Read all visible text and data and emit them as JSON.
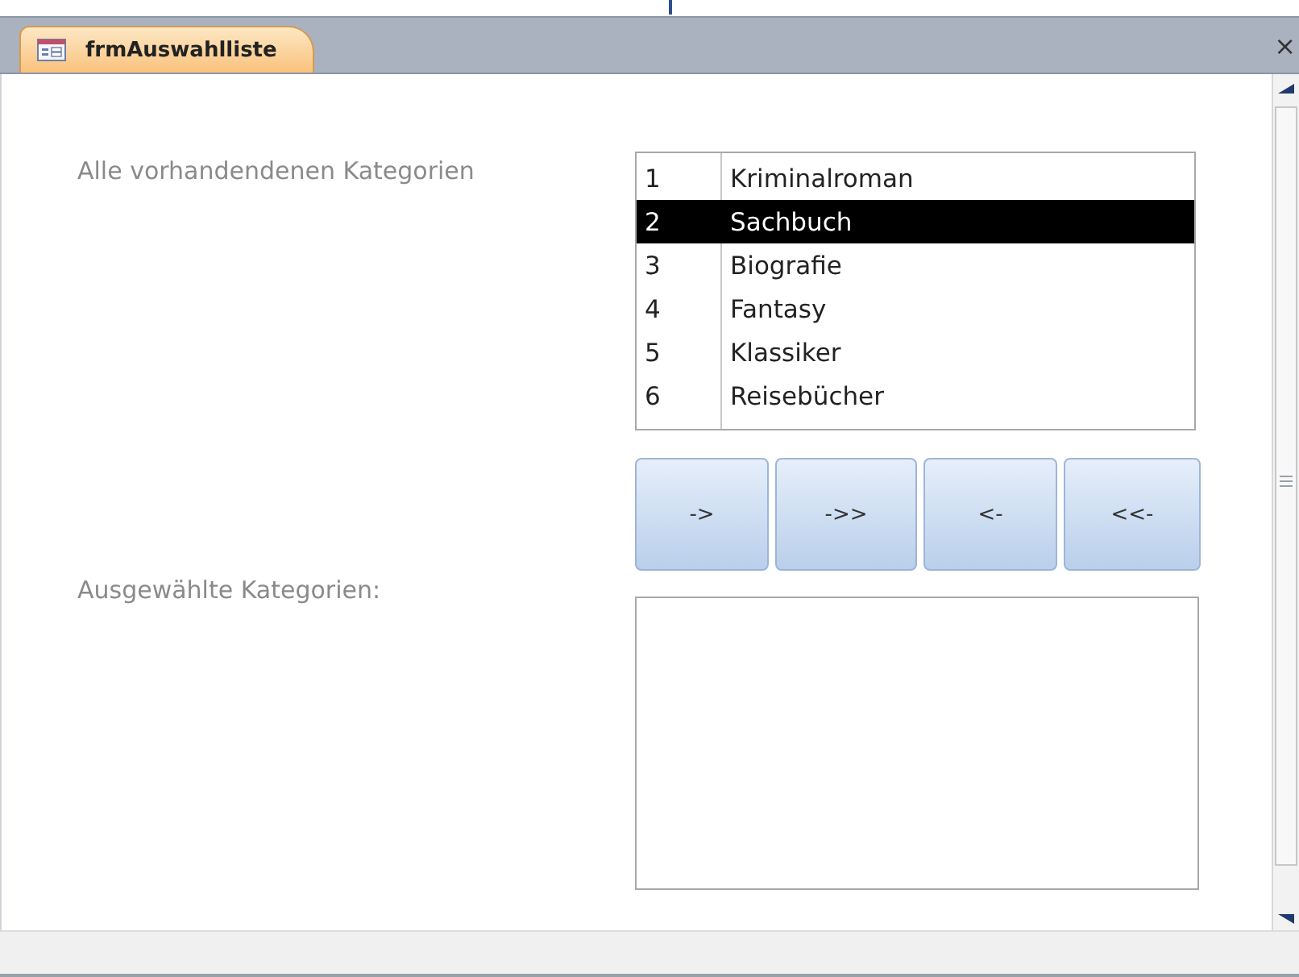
{
  "document_tab": {
    "title": "frmAuswahlliste",
    "close": "×"
  },
  "available": {
    "label": "Alle vorhandendenen Kategorien",
    "rows": [
      {
        "id": "1",
        "name": "Kriminalroman",
        "selected": false
      },
      {
        "id": "2",
        "name": "Sachbuch",
        "selected": true
      },
      {
        "id": "3",
        "name": "Biografie",
        "selected": false
      },
      {
        "id": "4",
        "name": "Fantasy",
        "selected": false
      },
      {
        "id": "5",
        "name": "Klassiker",
        "selected": false
      },
      {
        "id": "6",
        "name": "Reisebücher",
        "selected": false
      }
    ]
  },
  "buttons": [
    "->",
    "->>",
    "<-",
    "<<-"
  ],
  "chosen": {
    "label": "Ausgewählte Kategorien:"
  }
}
